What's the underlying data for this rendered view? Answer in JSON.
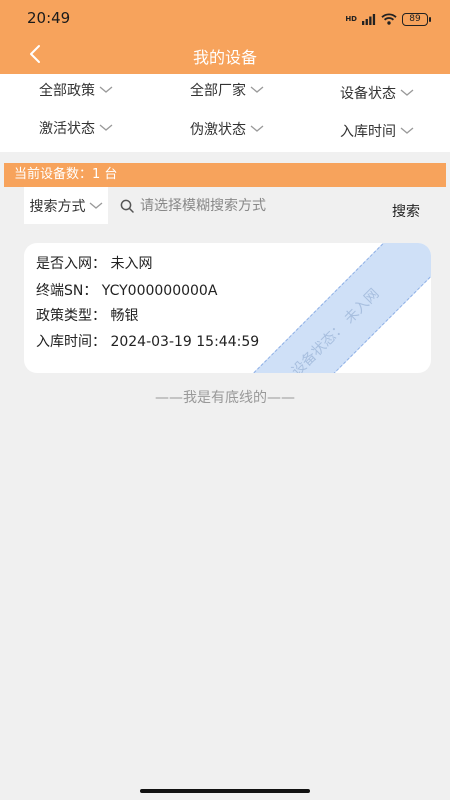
{
  "status": {
    "time": "20:49",
    "battery": "89",
    "network": "HD"
  },
  "nav": {
    "title": "我的设备"
  },
  "filters": [
    {
      "label": "全部政策"
    },
    {
      "label": "全部厂家"
    },
    {
      "label": "设备状态"
    },
    {
      "label": "激活状态"
    },
    {
      "label": "伪激状态"
    },
    {
      "label": "入库时间"
    }
  ],
  "count_bar": {
    "text": "当前设备数：1 台"
  },
  "search": {
    "mode_label": "搜索方式",
    "placeholder": "请选择模糊搜索方式",
    "button_label": "搜索"
  },
  "device": {
    "network_line": "是否入网：  未入网",
    "sn_line": "终端SN：  YCY000000000A",
    "policy_line": "政策类型：  畅银",
    "time_line": "入库时间：  2024-03-19 15:44:59",
    "status_ribbon": "设备状态：  未入网"
  },
  "footer": {
    "text": "——我是有底线的——"
  }
}
